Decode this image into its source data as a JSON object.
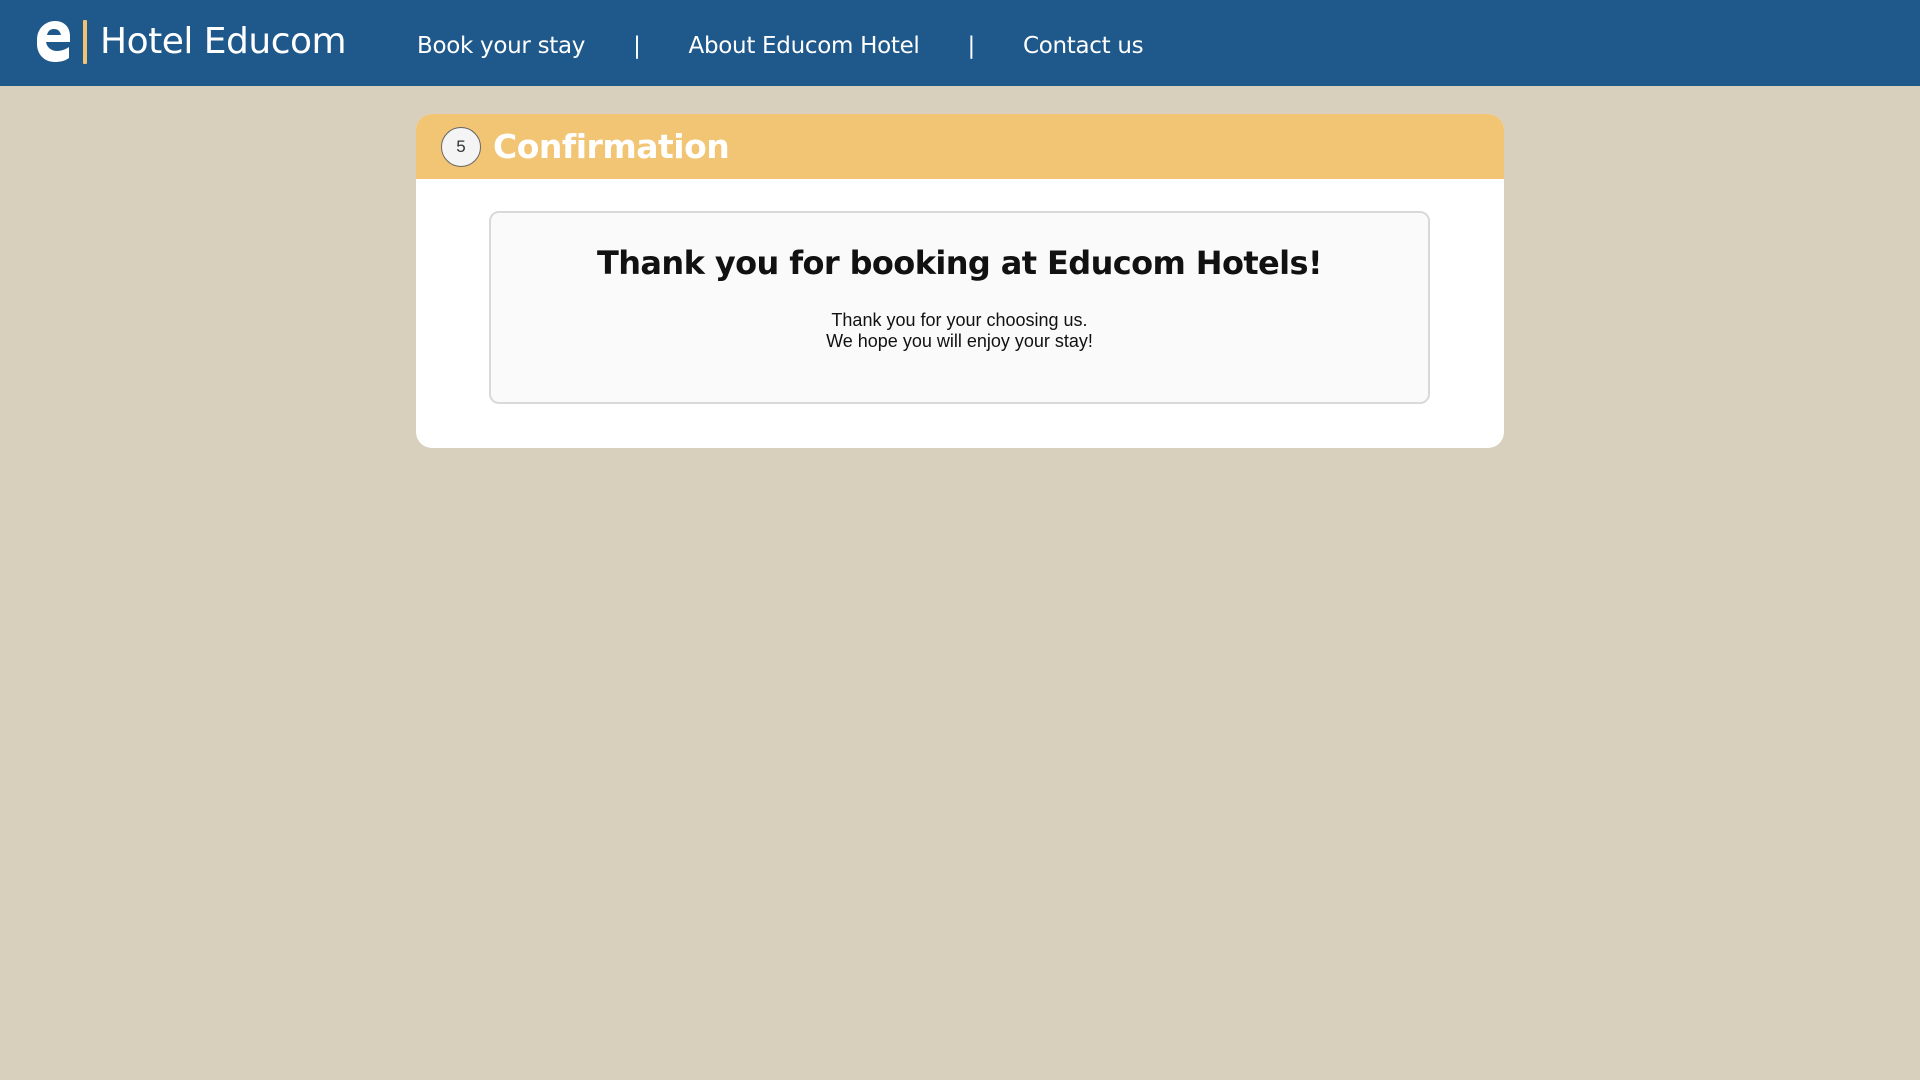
{
  "header": {
    "brand_name": "Hotel Educom",
    "nav": [
      {
        "label": "Book your stay"
      },
      {
        "label": "About Educom Hotel"
      },
      {
        "label": "Contact us"
      }
    ],
    "separator": "|"
  },
  "step": {
    "number": "5",
    "title": "Confirmation"
  },
  "confirmation": {
    "heading": "Thank you for booking at Educom Hotels!",
    "line1": "Thank you for your choosing us.",
    "line2": "We hope you will enjoy your stay!"
  },
  "colors": {
    "header_bg": "#1f598b",
    "accent": "#f1c473",
    "page_bg": "#d8d0bd"
  }
}
